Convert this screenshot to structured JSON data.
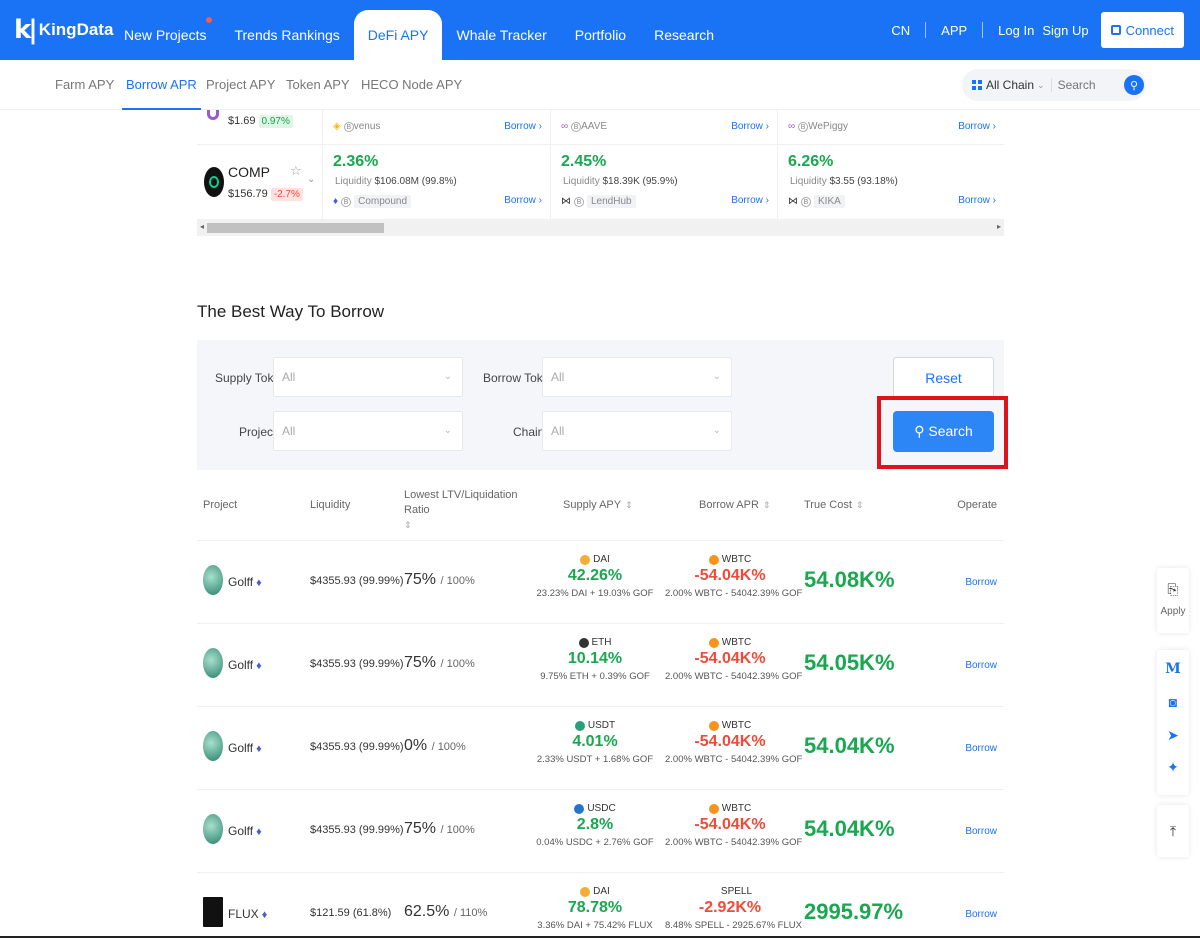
{
  "brand": {
    "name": "KingData"
  },
  "nav": {
    "items": [
      "New Projects",
      "Trends Rankings",
      "DeFi APY",
      "Whale Tracker",
      "Portfolio",
      "Research"
    ],
    "right": {
      "cn": "CN",
      "app": "APP",
      "login": "Log In",
      "signup": "Sign Up",
      "connect": "Connect"
    }
  },
  "subnav": {
    "items": [
      "Farm APY",
      "Borrow APR",
      "Project APY",
      "Token APY",
      "HECO Node APY"
    ],
    "chain": "All Chain",
    "search_placeholder": "Search"
  },
  "strip": {
    "row1": {
      "price": "$1.69",
      "change": "0.97%",
      "cells": [
        {
          "project": "venus",
          "borrow": "Borrow"
        },
        {
          "project": "AAVE",
          "borrow": "Borrow"
        },
        {
          "project": "WePiggy",
          "borrow": "Borrow"
        }
      ]
    },
    "row2": {
      "token": "COMP",
      "price": "$156.79",
      "change": "-2.7%",
      "cells": [
        {
          "apy": "2.36%",
          "liq_label": "Liquidity",
          "liq_value": "$106.08M",
          "liq_pct": "(99.8%)",
          "project": "Compound",
          "borrow": "Borrow"
        },
        {
          "apy": "2.45%",
          "liq_label": "Liquidity",
          "liq_value": "$18.39K",
          "liq_pct": "(95.9%)",
          "project": "LendHub",
          "borrow": "Borrow"
        },
        {
          "apy": "6.26%",
          "liq_label": "Liquidity",
          "liq_value": "$3.55",
          "liq_pct": "(93.18%)",
          "project": "KIKA",
          "borrow": "Borrow"
        }
      ]
    }
  },
  "section_title": "The Best Way To Borrow",
  "filter": {
    "supply_token_label": "Supply Token",
    "supply_token_value": "All",
    "borrow_token_label": "Borrow Token",
    "borrow_token_value": "All",
    "project_label": "Project",
    "project_value": "All",
    "chain_label": "Chain",
    "chain_value": "All",
    "reset": "Reset",
    "search": "Search"
  },
  "table": {
    "headers": {
      "project": "Project",
      "liquidity": "Liquidity",
      "ltv": "Lowest LTV/Liquidation Ratio",
      "supply": "Supply APY",
      "borrow": "Borrow APR",
      "true_cost": "True Cost",
      "operate": "Operate"
    },
    "rows": [
      {
        "project": "Golff",
        "liquidity": "$4355.93 (99.99%)",
        "ltv": "75%",
        "liq_ratio": "/ 100%",
        "supply_token": "DAI",
        "supply_apy": "42.26%",
        "supply_detail": "23.23% DAI + 19.03% GOF",
        "borrow_token": "WBTC",
        "borrow_apr": "-54.04K%",
        "borrow_detail": "2.00% WBTC - 54042.39% GOF",
        "true_cost": "54.08K%",
        "action": "Borrow"
      },
      {
        "project": "Golff",
        "liquidity": "$4355.93 (99.99%)",
        "ltv": "75%",
        "liq_ratio": "/ 100%",
        "supply_token": "ETH",
        "supply_apy": "10.14%",
        "supply_detail": "9.75% ETH + 0.39% GOF",
        "borrow_token": "WBTC",
        "borrow_apr": "-54.04K%",
        "borrow_detail": "2.00% WBTC - 54042.39% GOF",
        "true_cost": "54.05K%",
        "action": "Borrow"
      },
      {
        "project": "Golff",
        "liquidity": "$4355.93 (99.99%)",
        "ltv": "0%",
        "liq_ratio": "/ 100%",
        "supply_token": "USDT",
        "supply_apy": "4.01%",
        "supply_detail": "2.33% USDT + 1.68% GOF",
        "borrow_token": "WBTC",
        "borrow_apr": "-54.04K%",
        "borrow_detail": "2.00% WBTC - 54042.39% GOF",
        "true_cost": "54.04K%",
        "action": "Borrow"
      },
      {
        "project": "Golff",
        "liquidity": "$4355.93 (99.99%)",
        "ltv": "75%",
        "liq_ratio": "/ 100%",
        "supply_token": "USDC",
        "supply_apy": "2.8%",
        "supply_detail": "0.04% USDC + 2.76% GOF",
        "borrow_token": "WBTC",
        "borrow_apr": "-54.04K%",
        "borrow_detail": "2.00% WBTC - 54042.39% GOF",
        "true_cost": "54.04K%",
        "action": "Borrow"
      },
      {
        "project": "FLUX",
        "liquidity": "$121.59 (61.8%)",
        "ltv": "62.5%",
        "liq_ratio": "/ 110%",
        "supply_token": "DAI",
        "supply_apy": "78.78%",
        "supply_detail": "3.36% DAI + 75.42% FLUX",
        "borrow_token": "SPELL",
        "borrow_apr": "-2.92K%",
        "borrow_detail": "8.48% SPELL - 2925.67% FLUX",
        "true_cost": "2995.97%",
        "action": "Borrow"
      }
    ]
  },
  "floating": {
    "apply": "Apply"
  },
  "colors": {
    "primary": "#1a73f5",
    "green": "#19a84f",
    "red": "#f04b3a",
    "highlight": "#e0131d"
  }
}
